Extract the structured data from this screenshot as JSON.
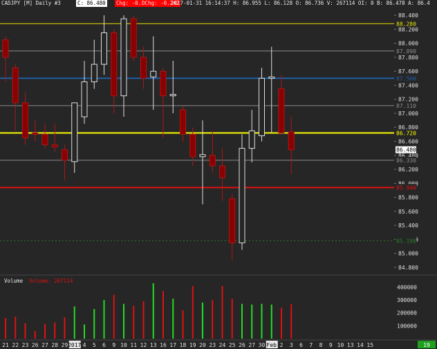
{
  "header": {
    "symbol": "CADJPY [M]",
    "period": "Daily",
    "id": "#3",
    "close": "C: 86.480",
    "chg": "Chg: -0.242",
    "dchg": "DChg: -0.242",
    "info": "2017-01-31 16:14:37 H: 86.955 L: 86.128 O: 86.736 V: 267114 OI: 0 B: 86.478 A: 86.4"
  },
  "price_labels": [
    "88.400",
    "88.200",
    "88.000",
    "87.800",
    "87.600",
    "87.400",
    "87.200",
    "87.000",
    "86.800",
    "86.600",
    "86.400",
    "86.200",
    "86.000",
    "85.800",
    "85.600",
    "85.400",
    "85.200",
    "85.000",
    "84.800"
  ],
  "last_price_tag": "86.480",
  "hlines": [
    {
      "value": 88.28,
      "label": "88.280",
      "color": "#e8e000",
      "width": 1,
      "kind": "line"
    },
    {
      "value": 87.89,
      "label": "87.890",
      "color": "#8c8c8c",
      "width": 1,
      "kind": "line"
    },
    {
      "value": 87.5,
      "label": "87.500",
      "color": "#1f5fa8",
      "width": 2,
      "kind": "box"
    },
    {
      "value": 87.11,
      "label": "87.110",
      "color": "#8c8c8c",
      "width": 1,
      "kind": "line"
    },
    {
      "value": 86.72,
      "label": "86.720",
      "color": "#ffff00",
      "width": 2,
      "kind": "line"
    },
    {
      "value": 86.33,
      "label": "86.330",
      "color": "#8c8c8c",
      "width": 1,
      "kind": "line"
    },
    {
      "value": 85.94,
      "label": "85.940",
      "color": "#e01010",
      "width": 2,
      "kind": "box"
    },
    {
      "value": 85.18,
      "label": "85.180",
      "color": "#2a7a2a",
      "width": 1,
      "kind": "dash"
    }
  ],
  "volume": {
    "title": "Volume",
    "label": "Volume: 267114",
    "ticks": [
      "400000",
      "300000",
      "200000",
      "100000"
    ]
  },
  "x_labels": [
    "21",
    "22",
    "23",
    "26",
    "27",
    "28",
    "29",
    "2017",
    "4",
    "5",
    "6",
    "9",
    "10",
    "11",
    "12",
    "13",
    "16",
    "17",
    "18",
    "19",
    "20",
    "23",
    "24",
    "25",
    "26",
    "27",
    "30",
    "Feb",
    "2",
    "3",
    "6",
    "7",
    "8",
    "9",
    "10",
    "13",
    "14",
    "15"
  ],
  "current_day": "19",
  "chart_data": {
    "type": "candlestick",
    "title": "CADJPY [M] Daily",
    "ylim": [
      84.72,
      88.48
    ],
    "volume_ylim": [
      0,
      440000
    ],
    "candles": [
      {
        "date": "2016-12-20",
        "open": 87.8,
        "high": 88.1,
        "low": 87.45,
        "close": 88.05,
        "bull": false,
        "volume": 160000
      },
      {
        "date": "2016-12-21",
        "open": 87.65,
        "high": 87.7,
        "low": 86.75,
        "close": 87.15,
        "bull": false,
        "volume": 170000
      },
      {
        "date": "2016-12-22",
        "open": 87.15,
        "high": 87.3,
        "low": 86.55,
        "close": 86.65,
        "bull": false,
        "volume": 120000
      },
      {
        "date": "2016-12-23",
        "open": 86.72,
        "high": 86.9,
        "low": 86.6,
        "close": 86.7,
        "bull": false,
        "volume": 60000
      },
      {
        "date": "2016-12-26",
        "open": 86.7,
        "high": 86.85,
        "low": 86.5,
        "close": 86.55,
        "bull": false,
        "volume": 115000
      },
      {
        "date": "2016-12-27",
        "open": 86.55,
        "high": 86.85,
        "low": 86.45,
        "close": 86.52,
        "bull": false,
        "volume": 125000
      },
      {
        "date": "2016-12-28",
        "open": 86.48,
        "high": 86.55,
        "low": 86.05,
        "close": 86.33,
        "bull": false,
        "volume": 165000
      },
      {
        "date": "2016-12-29",
        "open": 86.31,
        "high": 87.15,
        "low": 86.15,
        "close": 87.15,
        "bull": true,
        "volume": 250000
      },
      {
        "date": "2016-12-30",
        "open": 86.95,
        "high": 87.75,
        "low": 86.85,
        "close": 87.45,
        "bull": true,
        "volume": 110000
      },
      {
        "date": "2017-01-03",
        "open": 87.45,
        "high": 88.05,
        "low": 87.35,
        "close": 87.7,
        "bull": true,
        "volume": 230000
      },
      {
        "date": "2017-01-04",
        "open": 87.7,
        "high": 88.4,
        "low": 87.55,
        "close": 88.15,
        "bull": true,
        "volume": 300000
      },
      {
        "date": "2017-01-05",
        "open": 88.15,
        "high": 88.2,
        "low": 87.0,
        "close": 87.25,
        "bull": false,
        "volume": 340000
      },
      {
        "date": "2017-01-06",
        "open": 87.25,
        "high": 88.4,
        "low": 86.95,
        "close": 88.35,
        "bull": true,
        "volume": 270000
      },
      {
        "date": "2017-01-09",
        "open": 88.35,
        "high": 88.4,
        "low": 87.75,
        "close": 87.8,
        "bull": false,
        "volume": 255000
      },
      {
        "date": "2017-01-10",
        "open": 87.8,
        "high": 87.95,
        "low": 87.35,
        "close": 87.5,
        "bull": false,
        "volume": 290000
      },
      {
        "date": "2017-01-11",
        "open": 87.52,
        "high": 88.1,
        "low": 87.05,
        "close": 87.6,
        "bull": true,
        "volume": 430000
      },
      {
        "date": "2017-01-12",
        "open": 87.6,
        "high": 87.65,
        "low": 86.65,
        "close": 87.25,
        "bull": false,
        "volume": 370000
      },
      {
        "date": "2017-01-13",
        "open": 87.25,
        "high": 87.75,
        "low": 87.0,
        "close": 87.27,
        "bull": true,
        "volume": 310000
      },
      {
        "date": "2017-01-16",
        "open": 87.05,
        "high": 87.1,
        "low": 86.6,
        "close": 86.7,
        "bull": false,
        "volume": 220000
      },
      {
        "date": "2017-01-17",
        "open": 86.7,
        "high": 86.8,
        "low": 86.25,
        "close": 86.38,
        "bull": false,
        "volume": 410000
      },
      {
        "date": "2017-01-18",
        "open": 86.38,
        "high": 86.9,
        "low": 85.7,
        "close": 86.41,
        "bull": true,
        "volume": 280000
      },
      {
        "date": "2017-01-19",
        "open": 86.4,
        "high": 86.75,
        "low": 86.15,
        "close": 86.25,
        "bull": false,
        "volume": 300000
      },
      {
        "date": "2017-01-20",
        "open": 86.25,
        "high": 86.5,
        "low": 85.75,
        "close": 86.08,
        "bull": false,
        "volume": 410000
      },
      {
        "date": "2017-01-23",
        "open": 85.78,
        "high": 85.85,
        "low": 84.9,
        "close": 85.15,
        "bull": false,
        "volume": 310000
      },
      {
        "date": "2017-01-24",
        "open": 85.15,
        "high": 86.7,
        "low": 85.05,
        "close": 86.5,
        "bull": true,
        "volume": 270000
      },
      {
        "date": "2017-01-25",
        "open": 86.5,
        "high": 87.05,
        "low": 86.3,
        "close": 86.75,
        "bull": true,
        "volume": 265000
      },
      {
        "date": "2017-01-26",
        "open": 86.68,
        "high": 87.65,
        "low": 86.6,
        "close": 87.5,
        "bull": true,
        "volume": 270000
      },
      {
        "date": "2017-01-27",
        "open": 87.5,
        "high": 87.95,
        "low": 86.72,
        "close": 87.52,
        "bull": true,
        "volume": 265000
      },
      {
        "date": "2017-01-30",
        "open": 87.35,
        "high": 87.55,
        "low": 86.7,
        "close": 86.72,
        "bull": false,
        "volume": 240000
      },
      {
        "date": "2017-01-31",
        "open": 86.736,
        "high": 86.955,
        "low": 86.128,
        "close": 86.48,
        "bull": false,
        "volume": 267114
      }
    ]
  },
  "colors": {
    "background": "#262626",
    "bull_fill": "#262626",
    "bull_border": "#e0e0e0",
    "bear_fill": "#8b0000",
    "bear_border": "#b01515",
    "vol_up": "#22dd22",
    "vol_down": "#dd1111",
    "close_box": "#ffffff",
    "chg_box": "#ff0000",
    "axis_text": "#e0e0e0",
    "current_day_bg": "#1fa01f"
  }
}
